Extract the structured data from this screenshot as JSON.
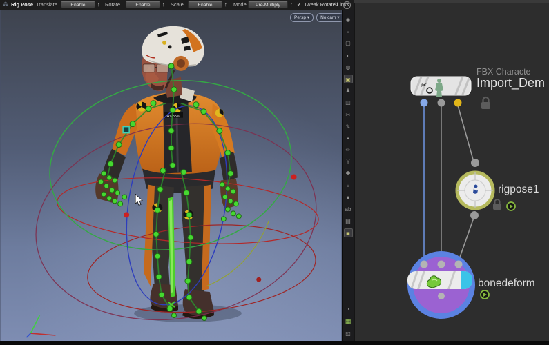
{
  "toolbar": {
    "state_icon": "⁂",
    "state_label": "Rig Pose",
    "params": [
      {
        "label": "Translate",
        "value": "Enable"
      },
      {
        "label": "Rotate",
        "value": "Enable"
      },
      {
        "label": "Scale",
        "value": "Enable"
      },
      {
        "label": "Mode",
        "value": "Pre-Multiply"
      }
    ],
    "spinner_icon": "↕",
    "tweak_checkbox": {
      "check_glyph": "✔",
      "label": "Tweak Rotate Links"
    },
    "sort_icon": "⇅",
    "help_icon": "?"
  },
  "viewport": {
    "camera_menu": {
      "label": "Persp",
      "arrow": "▾"
    },
    "camera2_menu": {
      "label": "No cam",
      "arrow": "▾"
    },
    "chest_patch_label": "WORKS",
    "side_toolbar": [
      {
        "name": "view-tool-icon",
        "glyph": "◉"
      },
      {
        "name": "secure-lock-icon",
        "glyph": "◒"
      },
      {
        "name": "camera-icon",
        "glyph": "▢"
      },
      {
        "name": "shading-icon",
        "glyph": "◐"
      },
      {
        "name": "lighting-icon",
        "glyph": "◍"
      },
      {
        "name": "display-options-icon",
        "glyph": "▣"
      },
      {
        "name": "character-pick-icon",
        "glyph": "♟"
      },
      {
        "name": "snapshot-icon",
        "glyph": "◫"
      },
      {
        "name": "cut-icon",
        "glyph": "✂"
      },
      {
        "name": "draw-icon",
        "glyph": "✎"
      },
      {
        "name": "point-icon",
        "glyph": "•"
      },
      {
        "name": "edit-icon",
        "glyph": "✏"
      },
      {
        "name": "tripod-icon",
        "glyph": "Y"
      },
      {
        "name": "handles-icon",
        "glyph": "✚"
      },
      {
        "name": "select-icon",
        "glyph": "⌖"
      },
      {
        "name": "stop-icon",
        "glyph": "■"
      },
      {
        "name": "text-icon",
        "glyph": "ab"
      },
      {
        "name": "image-plane-icon",
        "glyph": "▤"
      },
      {
        "name": "headlight-icon",
        "glyph": "◙"
      }
    ],
    "bottom_tools": [
      {
        "name": "info-icon",
        "glyph": "◔"
      },
      {
        "name": "grid-snap-icon",
        "glyph": "▦"
      },
      {
        "name": "layout-icon",
        "glyph": "◱"
      }
    ],
    "colors": {
      "bg_top": "#3e434e",
      "bg_bottom": "#7e8db2",
      "joint_green": "#46d830",
      "ring_green": "#35a845",
      "ring_blue": "#2d3dbd",
      "ring_red": "#b52828"
    }
  },
  "network_editor": {
    "nodes": [
      {
        "id": "import",
        "type_label": "FBX Characte",
        "name": "Import_Dem",
        "locked": true,
        "output_colors": [
          "#86a9e8",
          "#9a9a9a",
          "#e2b619"
        ]
      },
      {
        "id": "rigpose",
        "name": "rigpose1",
        "locked": true,
        "time_dependent": true,
        "ring_color": "#b6ba5e"
      },
      {
        "id": "bonedeform",
        "name": "bonedeform",
        "time_dependent": true,
        "ring_color": "#5b82e2",
        "fill_color": "#9b62d2",
        "accent_color": "#3bc3e8"
      }
    ]
  }
}
